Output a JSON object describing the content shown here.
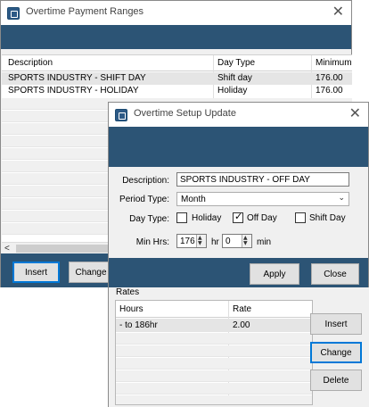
{
  "window1": {
    "title": "Overtime Payment Ranges",
    "close_glyph": "✕",
    "columns": [
      "Description",
      "Day Type",
      "Minimum"
    ],
    "rows": [
      {
        "description": "SPORTS INDUSTRY - SHIFT DAY",
        "day_type": "Shift day",
        "minimum": "176.00"
      },
      {
        "description": "SPORTS INDUSTRY - HOLIDAY",
        "day_type": "Holiday",
        "minimum": "176.00"
      }
    ],
    "scroll_left_glyph": "<",
    "buttons": {
      "insert": "Insert",
      "change": "Change"
    }
  },
  "window2": {
    "title": "Overtime Setup Update",
    "close_glyph": "✕",
    "description_label": "Description:",
    "description_value": "SPORTS INDUSTRY - OFF DAY",
    "period_type_label": "Period Type:",
    "period_type_value": "Month",
    "day_type_label": "Day Type:",
    "day_types": [
      {
        "label": "Holiday",
        "checked": false
      },
      {
        "label": "Off Day",
        "checked": true
      },
      {
        "label": "Shift Day",
        "checked": false
      }
    ],
    "min_hrs_label": "Min Hrs:",
    "min_hrs_hours": "176",
    "hr_label": "hr",
    "min_hrs_minutes": "0",
    "min_label": "min",
    "buttons": {
      "apply": "Apply",
      "close": "Close"
    }
  },
  "rates": {
    "label": "Rates",
    "columns": [
      "Hours",
      "Rate"
    ],
    "rows": [
      {
        "hours": "- to 186hr",
        "rate": "2.00"
      }
    ],
    "buttons": {
      "insert": "Insert",
      "change": "Change",
      "delete": "Delete"
    }
  },
  "colors": {
    "band": "#2c5475",
    "focus": "#0078d7",
    "window_bg": "#f0f0f0"
  },
  "icons": [
    "app-icon",
    "close-icon",
    "checkbox-check-icon",
    "chevron-down-icon",
    "spin-up-icon",
    "spin-down-icon",
    "scroll-left-icon"
  ]
}
